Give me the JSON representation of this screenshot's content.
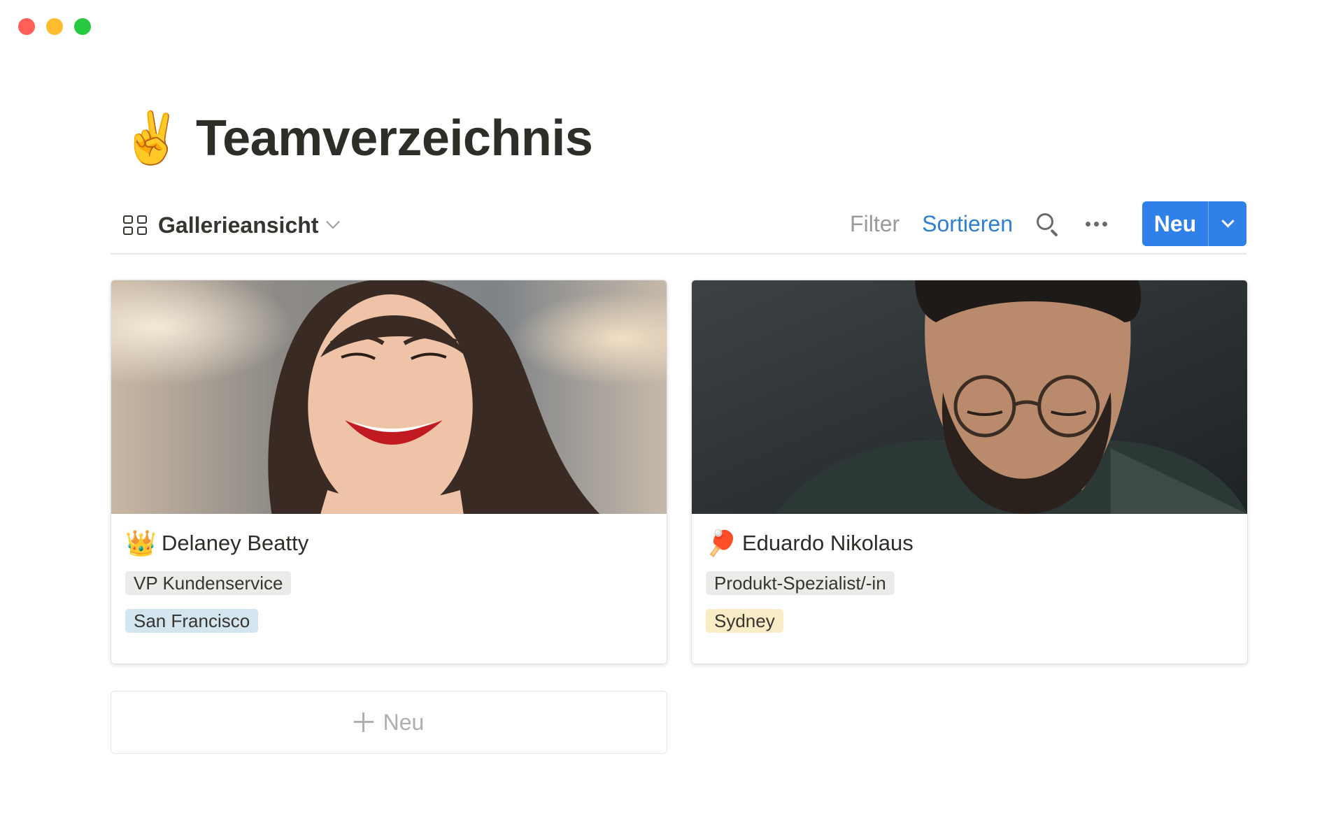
{
  "page": {
    "title": "Teamverzeichnis",
    "title_emoji": "✌️"
  },
  "toolbar": {
    "view_label": "Gallerieansicht",
    "filter_label": "Filter",
    "sort_label": "Sortieren",
    "new_label": "Neu",
    "sort_color": "#2f80d1",
    "new_color": "#2f80e8"
  },
  "cards": [
    {
      "emoji": "👑",
      "name": "Delaney Beatty",
      "role": "VP Kundenservice",
      "location": "San Francisco",
      "location_color": "#d3e5ef"
    },
    {
      "emoji": "🏓",
      "name": "Eduardo Nikolaus",
      "role": "Produkt-Spezialist/-in",
      "location": "Sydney",
      "location_color": "#fbecc8"
    }
  ],
  "gallery": {
    "add_new_label": "Neu"
  }
}
